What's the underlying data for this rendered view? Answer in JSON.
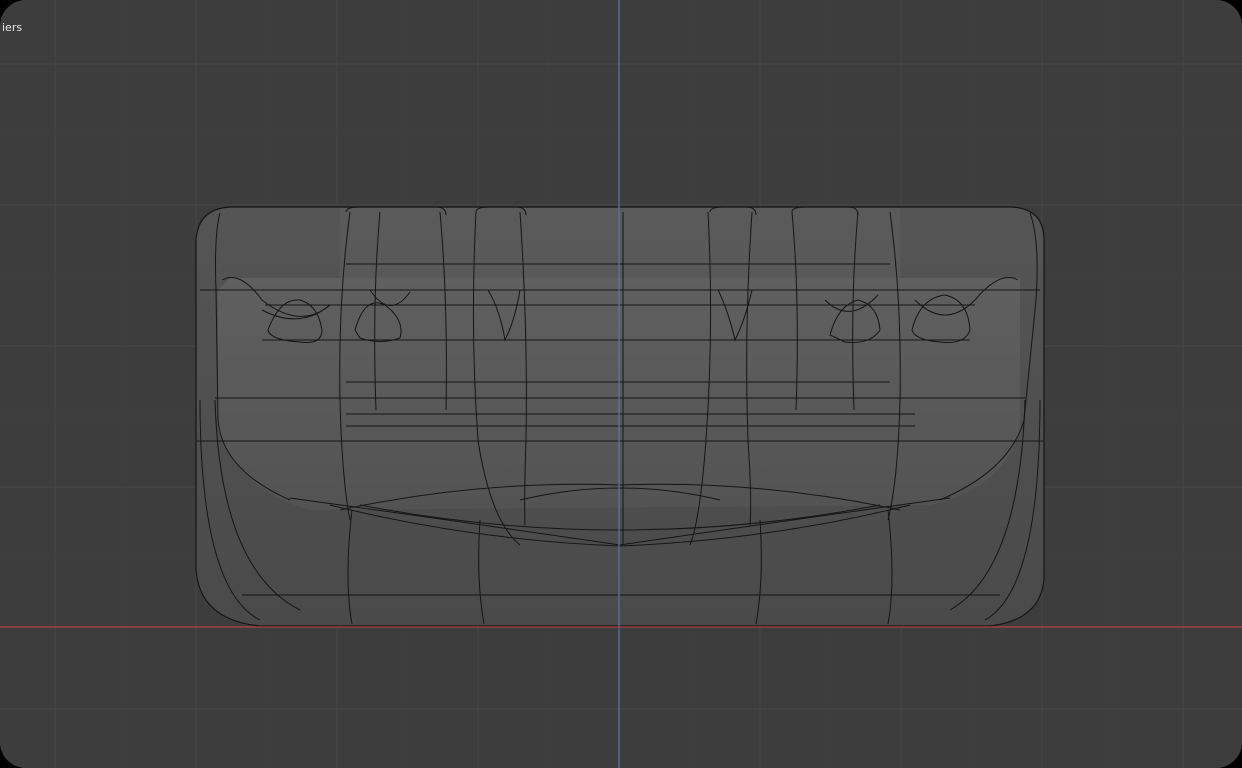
{
  "viewport": {
    "header_label": "iers",
    "background_color": "#3d3d3d",
    "grid_color": "#474747",
    "axis_x_color": "#b5404a",
    "axis_y_color": "#4a7bb0",
    "wire_color": "#151515",
    "shading": "wireframe-xray"
  }
}
